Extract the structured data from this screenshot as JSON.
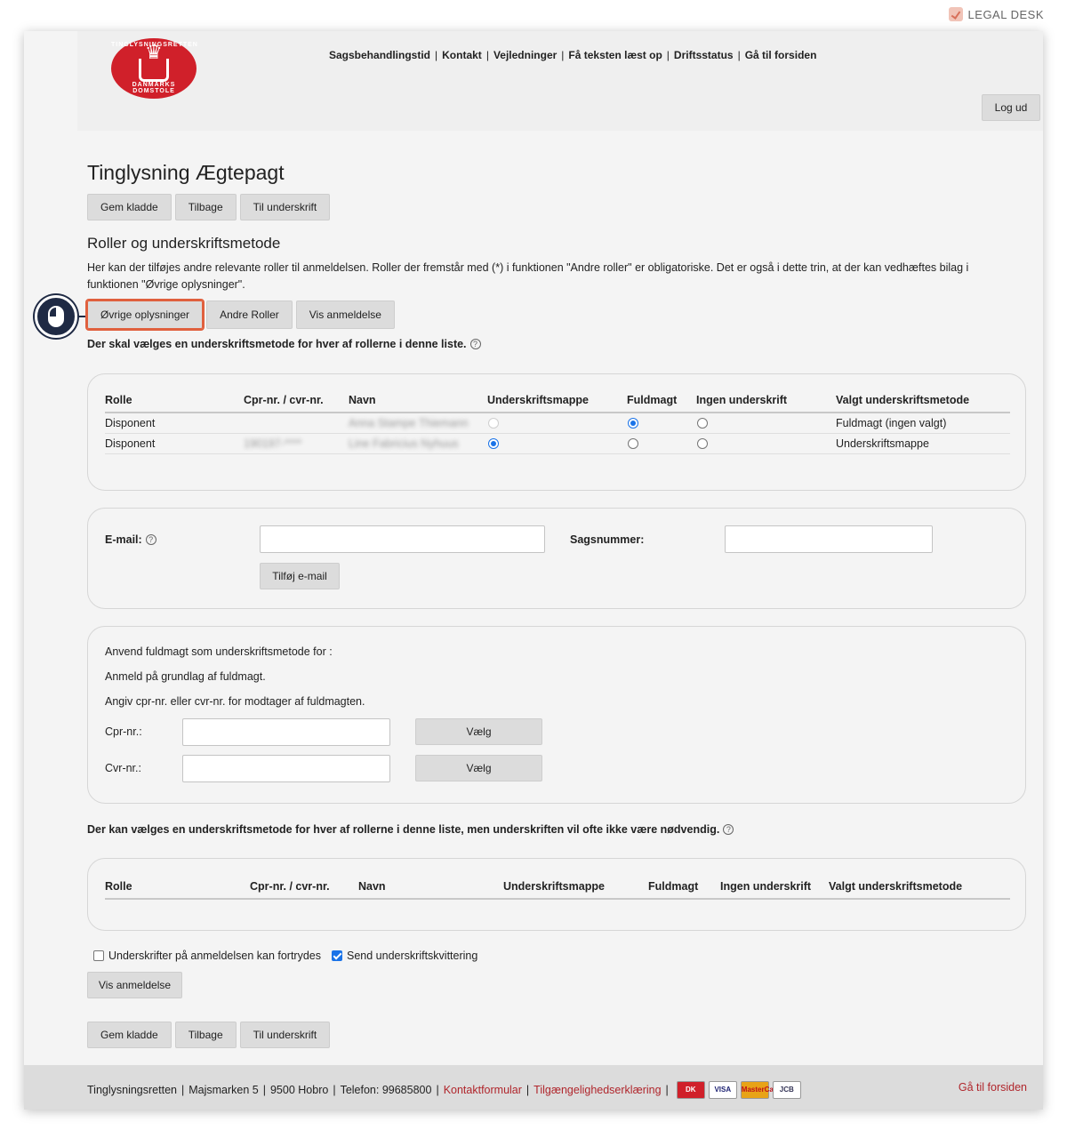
{
  "brand": {
    "label": "LEGAL DESK"
  },
  "logo": {
    "top_text": "TINGLYSNINGSRETTEN",
    "bottom_text": "DANMARKS DOMSTOLE",
    "icon": "crown-icon"
  },
  "topnav": {
    "items": [
      "Sagsbehandlingstid",
      "Kontakt",
      "Vejledninger",
      "Få teksten læst op",
      "Driftsstatus",
      "Gå til forsiden"
    ],
    "separator": "|"
  },
  "logout_label": "Log ud",
  "page_title": "Tinglysning Ægtepagt",
  "actions": {
    "save": "Gem kladde",
    "back": "Tilbage",
    "sign": "Til underskrift"
  },
  "section": {
    "title": "Roller og underskriftsmetode",
    "description": "Her kan der tilføjes andre relevante roller til anmeldelsen. Roller der fremstår med (*) i funktionen \"Andre roller\" er obligatoriske. Det er også i dette trin, at der kan vedhæftes bilag i funktionen \"Øvrige oplysninger\"."
  },
  "tabs": [
    "Øvrige oplysninger",
    "Andre Roller",
    "Vis anmeldelse"
  ],
  "required_note": "Der skal vælges en underskriftsmetode for hver af rollerne i denne liste.",
  "optional_note": "Der kan vælges en underskriftsmetode for hver af rollerne i denne liste, men underskriften vil ofte ikke være nødvendig.",
  "help_glyph": "?",
  "table_headers": [
    "Rolle",
    "Cpr-nr. / cvr-nr.",
    "Navn",
    "Underskriftsmappe",
    "Fuldmagt",
    "Ingen underskrift",
    "Valgt underskriftsmetode"
  ],
  "roles": [
    {
      "rolle": "Disponent",
      "id": "",
      "navn": "Anna Stampe Thiemann",
      "method": "fuldmagt",
      "mappe_disabled": true,
      "valgt": "Fuldmagt (ingen valgt)"
    },
    {
      "rolle": "Disponent",
      "id": "190197-****",
      "navn": "Line Fabricius Nyhuus",
      "method": "mappe",
      "mappe_disabled": false,
      "valgt": "Underskriftsmappe"
    }
  ],
  "email_section": {
    "email_label": "E-mail:",
    "email_value": "",
    "case_label": "Sagsnummer:",
    "case_value": "",
    "add_email_button": "Tilføj e-mail"
  },
  "proxy_section": {
    "line1": "Anvend fuldmagt som underskriftsmetode for :",
    "line2": "Anmeld på grundlag af fuldmagt.",
    "line3": "Angiv cpr-nr. eller cvr-nr. for modtager af fuldmagten.",
    "cpr_label": "Cpr-nr.:",
    "cvr_label": "Cvr-nr.:",
    "choose_button": "Vælg"
  },
  "options": {
    "revocable_label": "Underskrifter på anmeldelsen kan fortrydes",
    "revocable_checked": false,
    "receipt_label": "Send underskriftskvittering",
    "receipt_checked": true
  },
  "show_button": "Vis anmeldelse",
  "footer": {
    "org": "Tinglysningsretten",
    "address": "Majsmarken 5",
    "city": "9500 Hobro",
    "phone": "Telefon: 99685800",
    "contact_link": "Kontaktformular",
    "access_link": "Tilgængelighedserklæring",
    "home_link": "Gå til forsiden",
    "cards": [
      "DK",
      "VISA",
      "MasterCard",
      "JCB"
    ]
  },
  "colors": {
    "accent_red": "#b0262c",
    "highlight": "#e0603e",
    "radio_blue": "#1a73e8"
  }
}
